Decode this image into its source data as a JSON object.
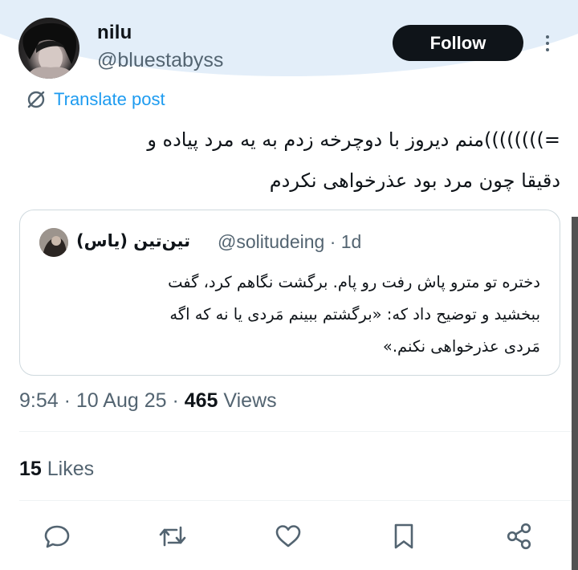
{
  "author": {
    "display_name": "nilu",
    "handle": "@bluestabyss"
  },
  "follow_label": "Follow",
  "translate_label": "Translate post",
  "tweet": {
    "lines": [
      "=))))))))منم دیروز با دوچرخه زدم به یه مرد پیاده و",
      "دقیقا چون مرد بود عذرخواهی نکردم"
    ]
  },
  "quote": {
    "name": "تین‌تین (یاس)",
    "handle": "@solitudeing",
    "time": "· 1d",
    "lines": [
      "دختره تو مترو پاش رفت رو پام. برگشت نگاهم کرد، گفت",
      "ببخشید و توضیح داد که: «برگشتم ببینم مَردی یا نه که اگه",
      "مَردی عذرخواهی نکنم.»"
    ]
  },
  "meta": {
    "time": "9:54",
    "date": "10 Aug 25",
    "views_count": "465",
    "views_label": "Views"
  },
  "likes": {
    "count": "15",
    "label": "Likes"
  },
  "icons": {
    "translate": "no-translate-icon",
    "more": "more-dots-icon",
    "reply": "reply-icon",
    "retweet": "retweet-icon",
    "like": "heart-icon",
    "bookmark": "bookmark-icon",
    "share": "share-icon"
  }
}
